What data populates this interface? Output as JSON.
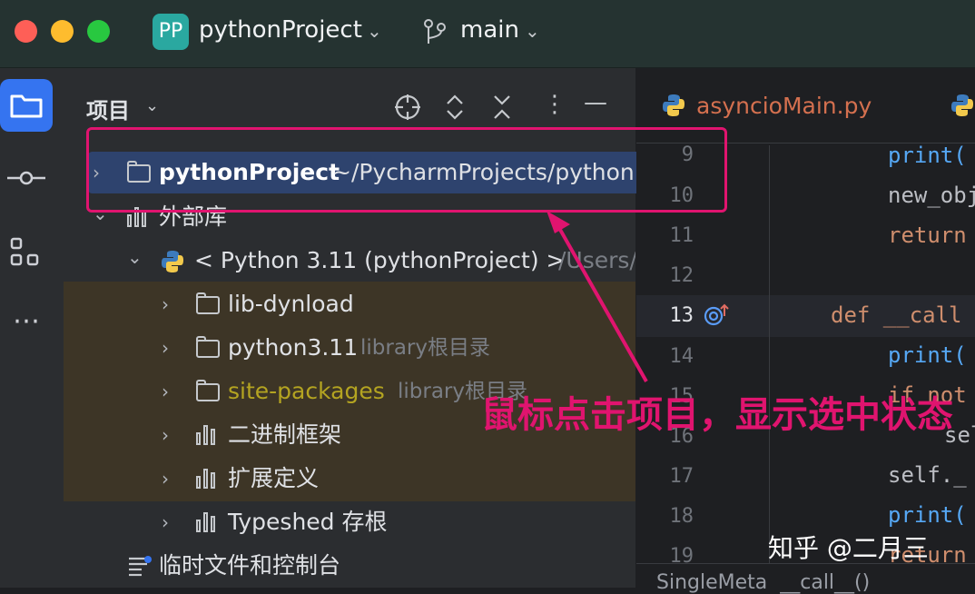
{
  "titlebar": {
    "project_badge": "PP",
    "project_name": "pythonProject",
    "branch_name": "main"
  },
  "sidebar": {
    "icons": [
      "folder-icon",
      "commit-icon",
      "structure-icon",
      "more-icon"
    ]
  },
  "panel": {
    "title": "项目",
    "toolbar_icons": [
      "locate-icon",
      "expand-icon",
      "collapse-icon",
      "options-icon",
      "hide-icon"
    ]
  },
  "tree": {
    "root": {
      "name": "pythonProject",
      "path": "~/PycharmProjects/pythonProject"
    },
    "external_libs": "外部库",
    "interpreter": {
      "name": "< Python 3.11 (pythonProject) >",
      "path": "/Users/"
    },
    "items": [
      {
        "name": "lib-dynload",
        "hint": ""
      },
      {
        "name": "python3.11",
        "hint": "library根目录"
      },
      {
        "name": "site-packages",
        "hint": "library根目录"
      },
      {
        "name": "二进制框架",
        "hint": ""
      },
      {
        "name": "扩展定义",
        "hint": ""
      },
      {
        "name": "Typeshed 存根",
        "hint": ""
      }
    ],
    "scratches": "临时文件和控制台"
  },
  "editor": {
    "tab": "asyncioMain.py",
    "lines": [
      {
        "no": "9",
        "code": "print("
      },
      {
        "no": "10",
        "code": "new_obj"
      },
      {
        "no": "11",
        "code": "return"
      },
      {
        "no": "12",
        "code": ""
      },
      {
        "no": "13",
        "code": "def __call"
      },
      {
        "no": "14",
        "code": "print("
      },
      {
        "no": "15",
        "code": "if not"
      },
      {
        "no": "16",
        "code": "sel"
      },
      {
        "no": "17",
        "code": "self._"
      },
      {
        "no": "18",
        "code": "print("
      },
      {
        "no": "19",
        "code": "return"
      }
    ],
    "breadcrumb": "SingleMeta  __call__()"
  },
  "annotation": "鼠标点击项目，显示选中状态",
  "watermark": "知乎 @二月三",
  "colors": {
    "accent": "#3574f0",
    "annotation": "#e0146f",
    "selection": "#2e436e"
  }
}
